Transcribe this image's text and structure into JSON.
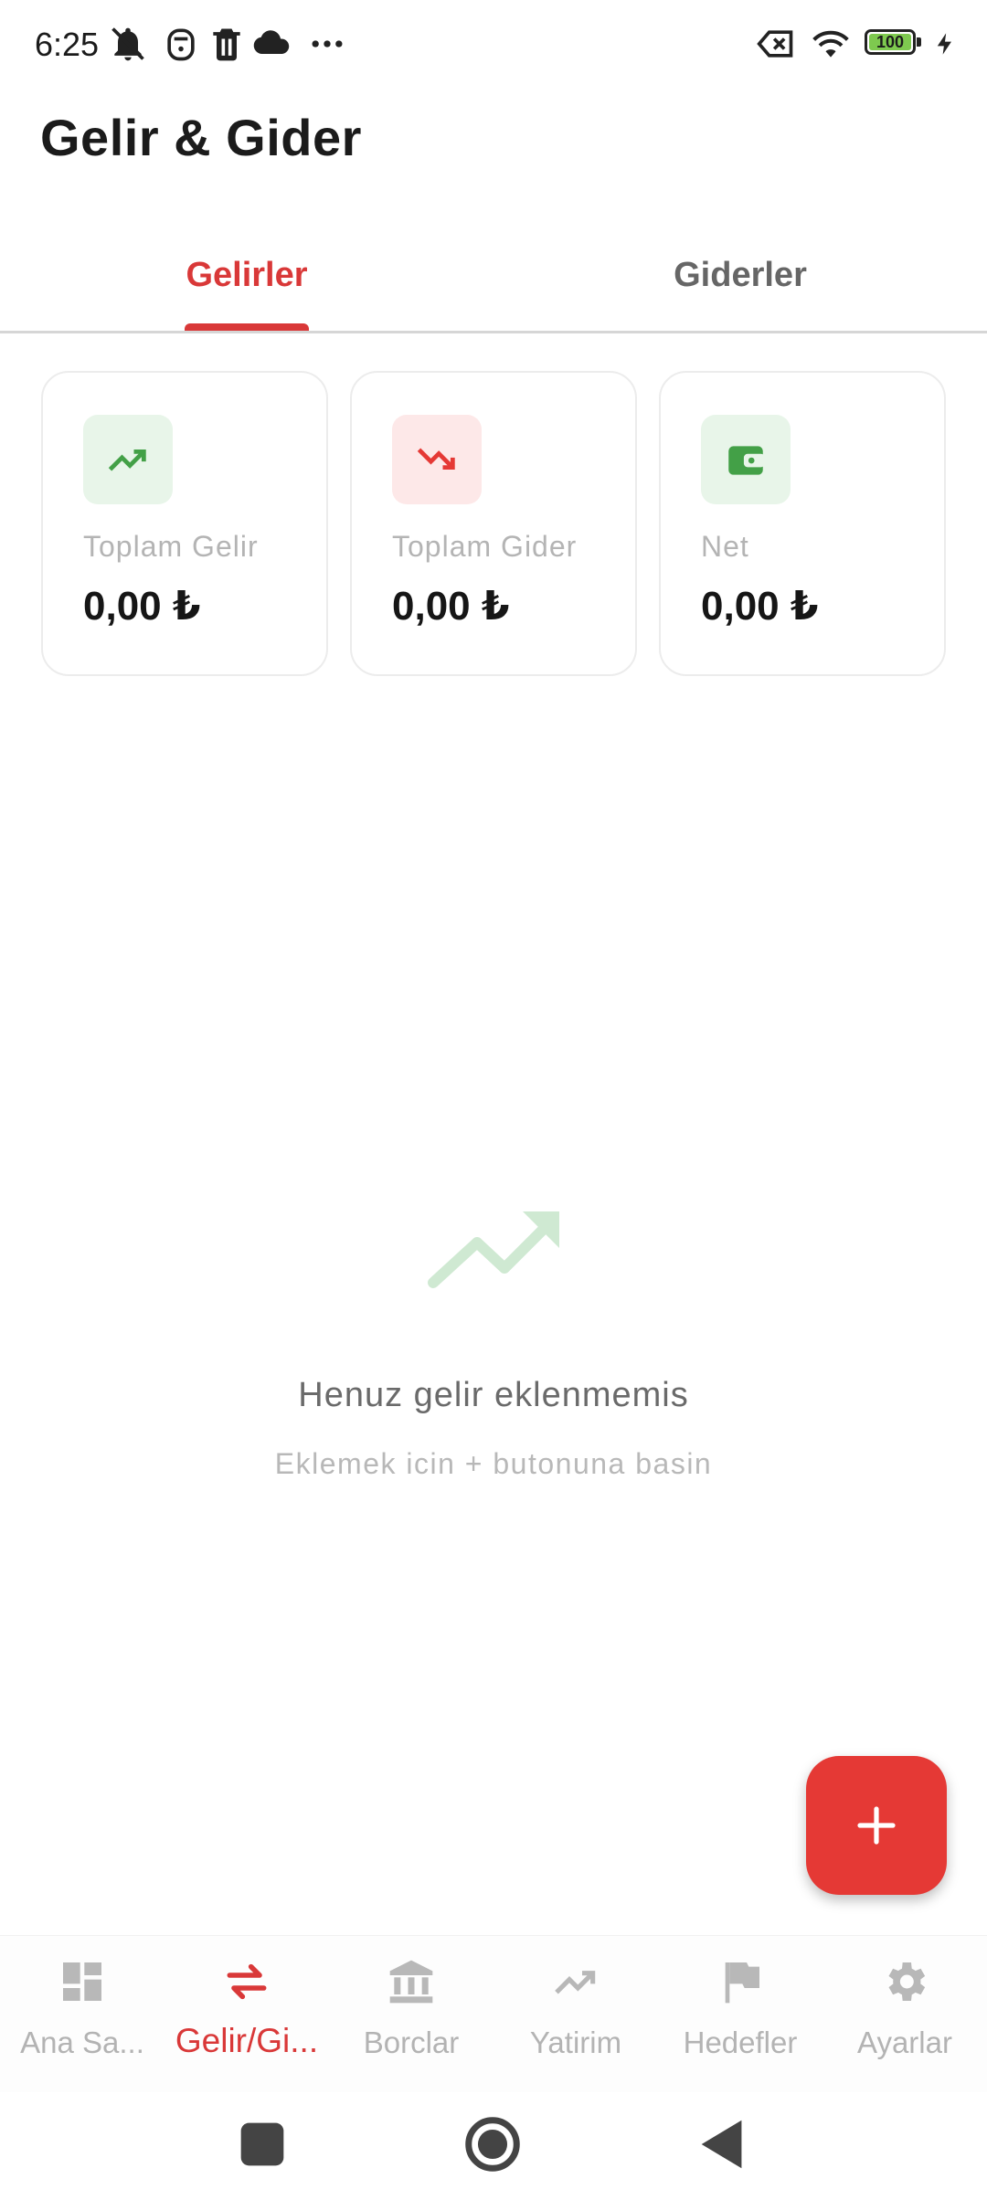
{
  "status_bar": {
    "time": "6:25",
    "left_icons": [
      "bell-muted-icon",
      "face-icon",
      "trash-icon",
      "cloud-icon",
      "more-dots-icon"
    ],
    "right_icons": [
      "no-sim-icon",
      "wifi-icon",
      "battery-icon",
      "charging-icon"
    ],
    "battery": "100"
  },
  "app_bar": {
    "title": "Gelir & Gider"
  },
  "tabs": [
    {
      "label": "Gelirler",
      "active": true
    },
    {
      "label": "Giderler",
      "active": false
    }
  ],
  "summary": [
    {
      "label": "Toplam Gelir",
      "value": "0,00 ₺",
      "icon": "trending-up-icon",
      "color": "#43a047",
      "bg": "#e8f5e9"
    },
    {
      "label": "Toplam Gider",
      "value": "0,00 ₺",
      "icon": "trending-down-icon",
      "color": "#e53935",
      "bg": "#fde8e8"
    },
    {
      "label": "Net",
      "value": "0,00 ₺",
      "icon": "wallet-icon",
      "color": "#43a047",
      "bg": "#e8f5e9"
    }
  ],
  "empty_state": {
    "icon": "trending-up-icon",
    "title": "Henuz gelir eklenmemis",
    "subtitle": "Eklemek icin + butonuna basin"
  },
  "fab": {
    "icon": "plus-icon",
    "color": "#e53935"
  },
  "bottom_nav": [
    {
      "label": "Ana Sa...",
      "icon": "dashboard-icon",
      "active": false
    },
    {
      "label": "Gelir/Gi...",
      "icon": "swap-arrows-icon",
      "active": true
    },
    {
      "label": "Borclar",
      "icon": "bank-icon",
      "active": false
    },
    {
      "label": "Yatirim",
      "icon": "trending-up-icon",
      "active": false
    },
    {
      "label": "Hedefler",
      "icon": "flag-icon",
      "active": false
    },
    {
      "label": "Ayarlar",
      "icon": "settings-gear-icon",
      "active": false
    }
  ],
  "system_nav": [
    "recents-button",
    "home-button",
    "back-button"
  ],
  "colors": {
    "accent": "#d93838",
    "income": "#43a047",
    "expense": "#e53935",
    "muted": "#b3b3b3"
  }
}
